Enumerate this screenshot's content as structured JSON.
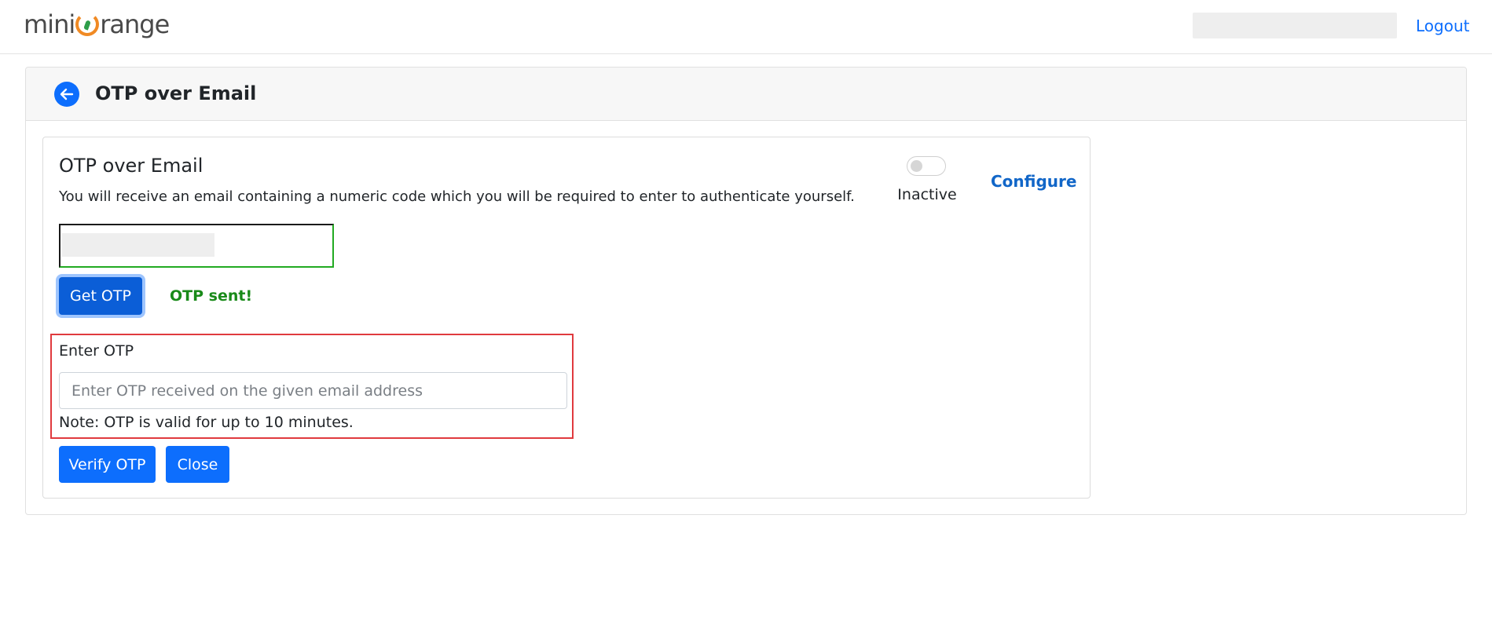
{
  "header": {
    "logo_text_prefix": "mini",
    "logo_text_suffix": "range",
    "logout_label": "Logout"
  },
  "page": {
    "title": "OTP over Email"
  },
  "method": {
    "title": "OTP over Email",
    "description": "You will receive an email containing a numeric code which you will be required to enter to authenticate yourself.",
    "status_label": "Inactive",
    "configure_label": "Configure"
  },
  "actions": {
    "get_otp_label": "Get OTP",
    "otp_sent_message": "OTP sent!",
    "verify_label": "Verify OTP",
    "close_label": "Close"
  },
  "otp_entry": {
    "label": "Enter OTP",
    "placeholder": "Enter OTP received on the given email address",
    "note": "Note: OTP is valid for up to 10 minutes."
  },
  "colors": {
    "primary": "#0d6efd",
    "success": "#198a19",
    "highlight_border": "#e03a3e",
    "logo_orange": "#f08a24"
  },
  "icons": {
    "back": "arrow-left-icon"
  }
}
